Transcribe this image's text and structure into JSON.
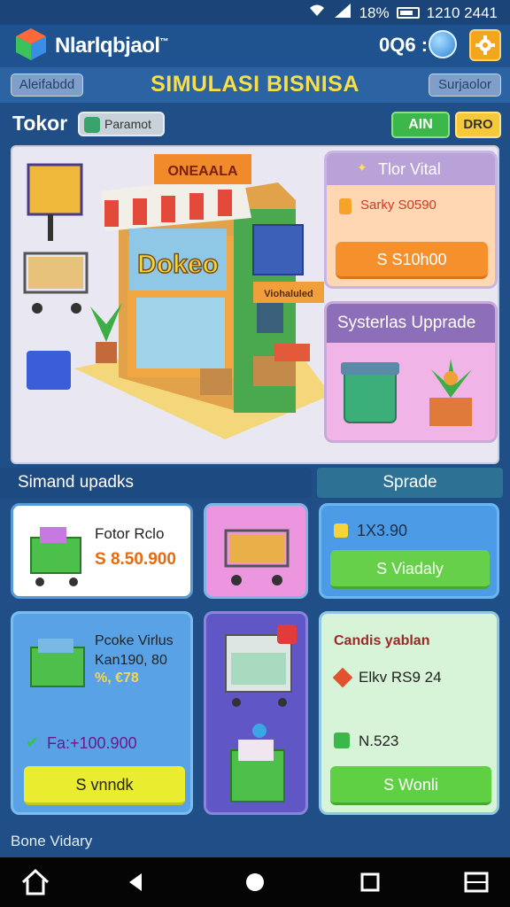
{
  "status_bar": {
    "battery": "18%",
    "time": "1210 2441"
  },
  "app_bar": {
    "title": "Nlarlqbjaol",
    "trademark": "™",
    "coins": "0Q6 :",
    "icons": [
      "game-logo-icon",
      "globe-icon",
      "gear-icon"
    ]
  },
  "header": {
    "left_pill": "Aleifabdd",
    "title": "SIMULASI BISNISA",
    "right_pill": "Surjaolor"
  },
  "toko": {
    "label": "Tokor",
    "param_label": "Paramot",
    "btn_green": "AIN",
    "btn_yellow": "DRO"
  },
  "scene": {
    "banner": "ONEAALA",
    "shop_sign": "Dokeo",
    "side_sign": "Viohaluled"
  },
  "vital_card": {
    "title": "Tlor Vital",
    "subtitle": "Sarky S0590",
    "price_button": "S S10h00"
  },
  "systems_card": {
    "title": "Systerlas Upprade"
  },
  "sections": {
    "left": "Simand upadks",
    "right": "Sprade"
  },
  "card1": {
    "title": "Fotor Rclo",
    "price": "S 8.50.900"
  },
  "card3": {
    "value": "1X3.90",
    "button": "S Viadaly"
  },
  "card4": {
    "line1": "Pcoke Virlus",
    "line2": "Kan190, 80",
    "line3": "%, €78",
    "value": "Fa:+100.900",
    "button": "S vnndk"
  },
  "card6": {
    "title": "Candis yablan",
    "line1": "Elkv RS9 24",
    "line2": "N.523",
    "button": "S Wonli"
  },
  "footer": {
    "text": "Bone Vidary"
  },
  "colors": {
    "accent_yellow": "#f8df47",
    "header_blue": "#2b63a3",
    "orange": "#f6902c",
    "green": "#67d04a"
  }
}
